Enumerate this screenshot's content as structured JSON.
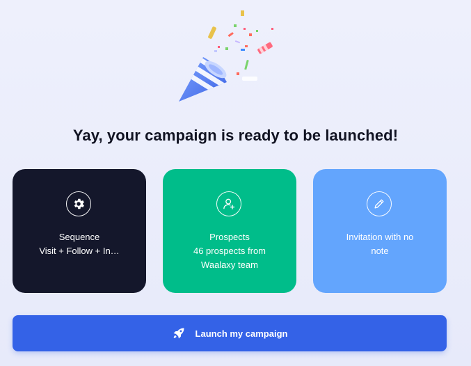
{
  "main": {
    "title": "Yay, your campaign is ready to be launched!"
  },
  "cards": [
    {
      "icon": "gear-icon",
      "line1": "Sequence",
      "line2": "Visit + Follow + In…"
    },
    {
      "icon": "user-add-icon",
      "line1": "Prospects",
      "line2": "46 prospects from",
      "line3": "Waalaxy team"
    },
    {
      "icon": "pencil-icon",
      "line1": "Invitation with no",
      "line2": "note"
    }
  ],
  "launch_button": {
    "icon": "rocket-icon",
    "label": "Launch my campaign"
  },
  "colors": {
    "background": "#eef0fc",
    "title": "#111322",
    "sequence_card": "#14172b",
    "prospects_card": "#00bd8a",
    "invitation_card": "#63a5fd",
    "launch_button": "#3462e7"
  }
}
